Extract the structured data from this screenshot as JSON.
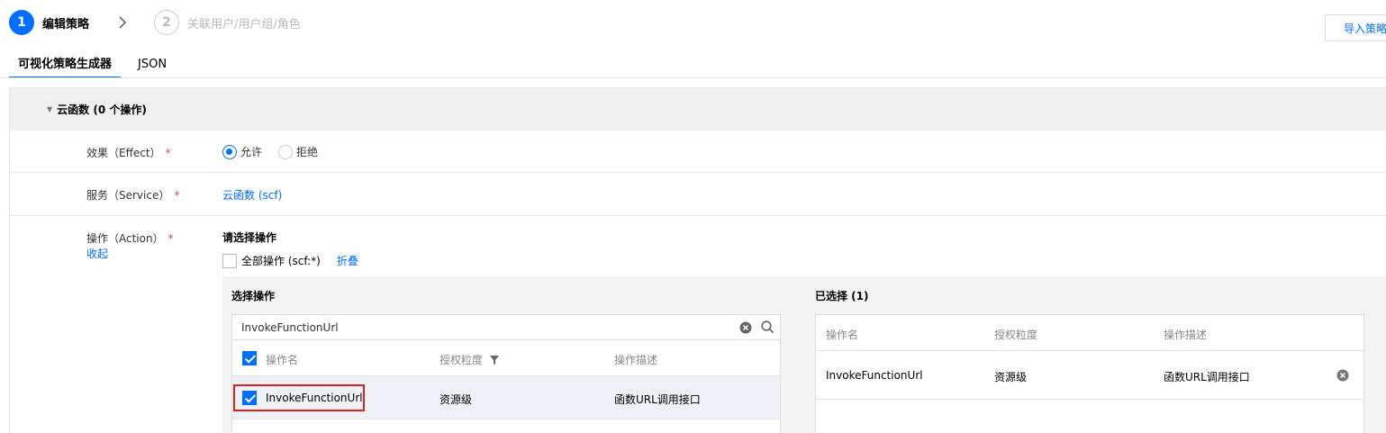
{
  "steps": [
    {
      "num": "1",
      "label": "编辑策略"
    },
    {
      "num": "2",
      "label": "关联用户/用户组/角色"
    }
  ],
  "import_button": "导入策略",
  "tabs": [
    {
      "label": "可视化策略生成器"
    },
    {
      "label": "JSON"
    }
  ],
  "panel": {
    "title": "云函数 (0 个操作)",
    "effect": {
      "label": "效果（Effect）",
      "required": "*",
      "options": [
        "允许",
        "拒绝"
      ],
      "selected": "允许"
    },
    "service": {
      "label": "服务（Service）",
      "required": "*",
      "value": "云函数 (scf)"
    },
    "action": {
      "label": "操作（Action）",
      "required": "*",
      "collapse_link": "收起",
      "prompt": "请选择操作",
      "all_ops_label": "全部操作 (scf:*)",
      "fold_link": "折叠",
      "select_title": "选择操作",
      "selected_title": "已选择 (1)",
      "search_value": "InvokeFunctionUrl",
      "columns": [
        "操作名",
        "授权粒度",
        "操作描述"
      ],
      "rows": [
        {
          "name": "InvokeFunctionUrl",
          "granularity": "资源级",
          "desc": "函数URL调用接口",
          "checked": true
        }
      ],
      "selected_rows": [
        {
          "name": "InvokeFunctionUrl",
          "granularity": "资源级",
          "desc": "函数URL调用接口"
        }
      ]
    }
  },
  "colors": {
    "accent": "#006eff",
    "highlight": "#e02020",
    "required": "#e54545"
  }
}
